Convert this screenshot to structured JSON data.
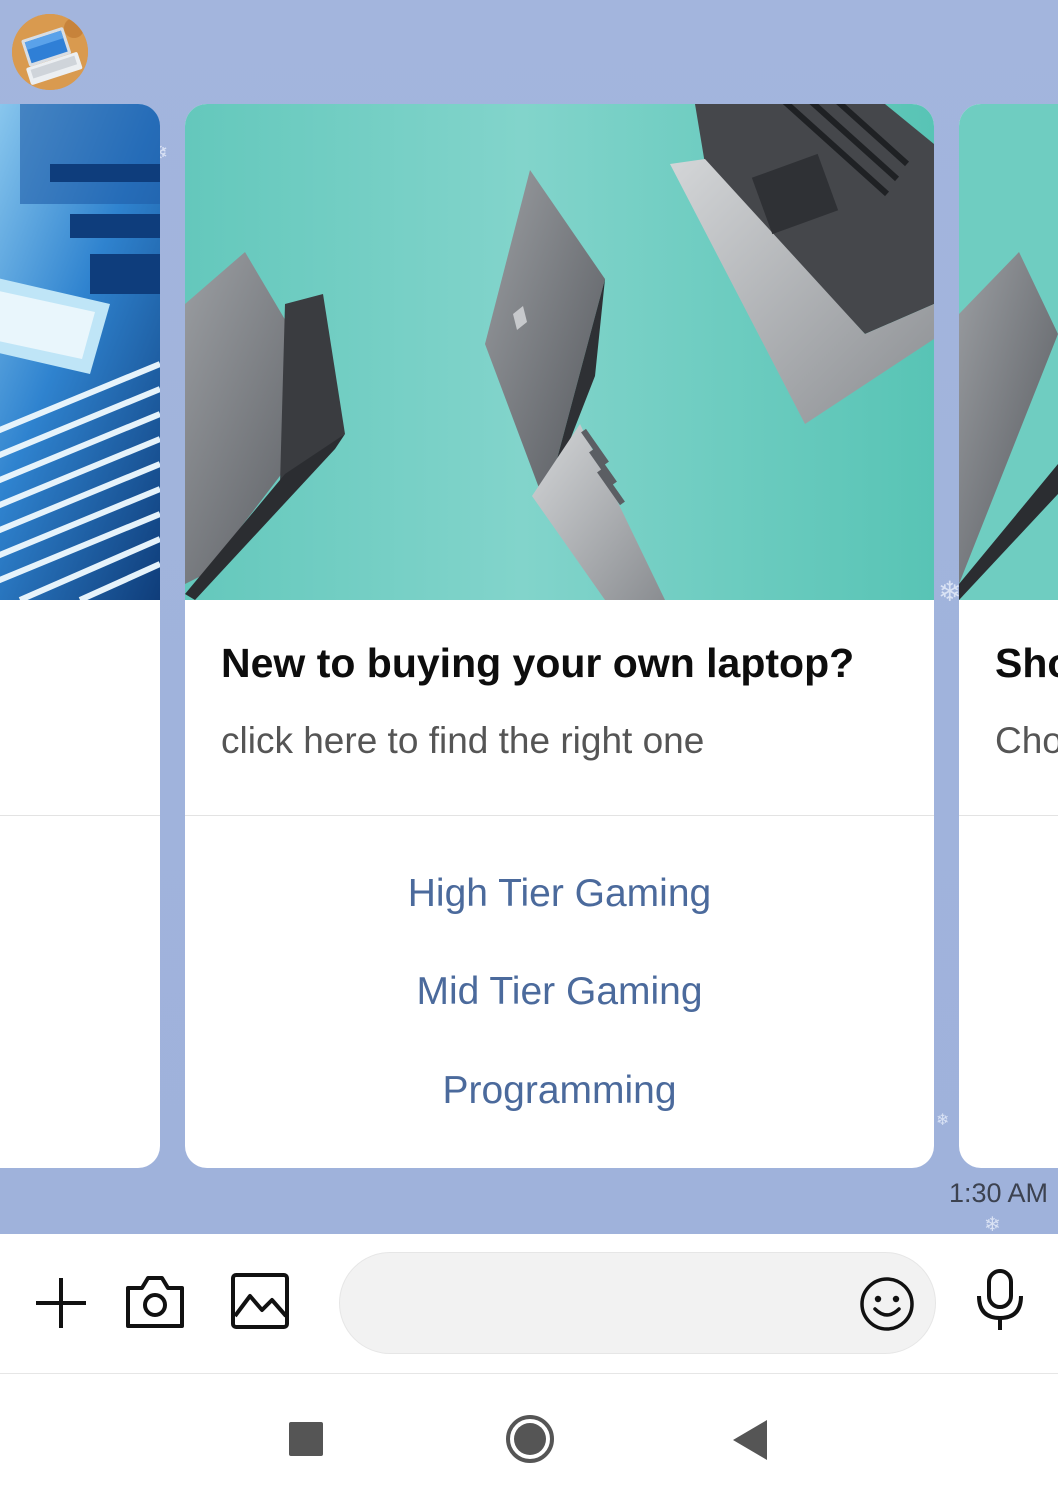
{
  "icons": {
    "bot_avatar": "laptop-avatar-icon",
    "add": "plus-icon",
    "camera": "camera-icon",
    "gallery": "image-icon",
    "emoji": "emoji-icon",
    "mic": "microphone-icon",
    "nav_recents": "square-icon",
    "nav_home": "circle-icon",
    "nav_back": "triangle-back-icon"
  },
  "colors": {
    "chat_background": "#a3b5dd",
    "card_background": "#ffffff",
    "action_text": "#4b6a9c",
    "image_teal": "#7fd2c9"
  },
  "carousel": {
    "cards": [
      {
        "title": "",
        "subtitle": ""
      },
      {
        "title": "New to buying your own laptop?",
        "subtitle": "click here to find the right one",
        "actions": [
          "High Tier Gaming",
          "Mid Tier Gaming",
          "Programming"
        ]
      },
      {
        "title": "Sho",
        "subtitle": "Cho"
      }
    ]
  },
  "message": {
    "time": "1:30 AM"
  },
  "composer": {
    "value": "",
    "placeholder": ""
  }
}
